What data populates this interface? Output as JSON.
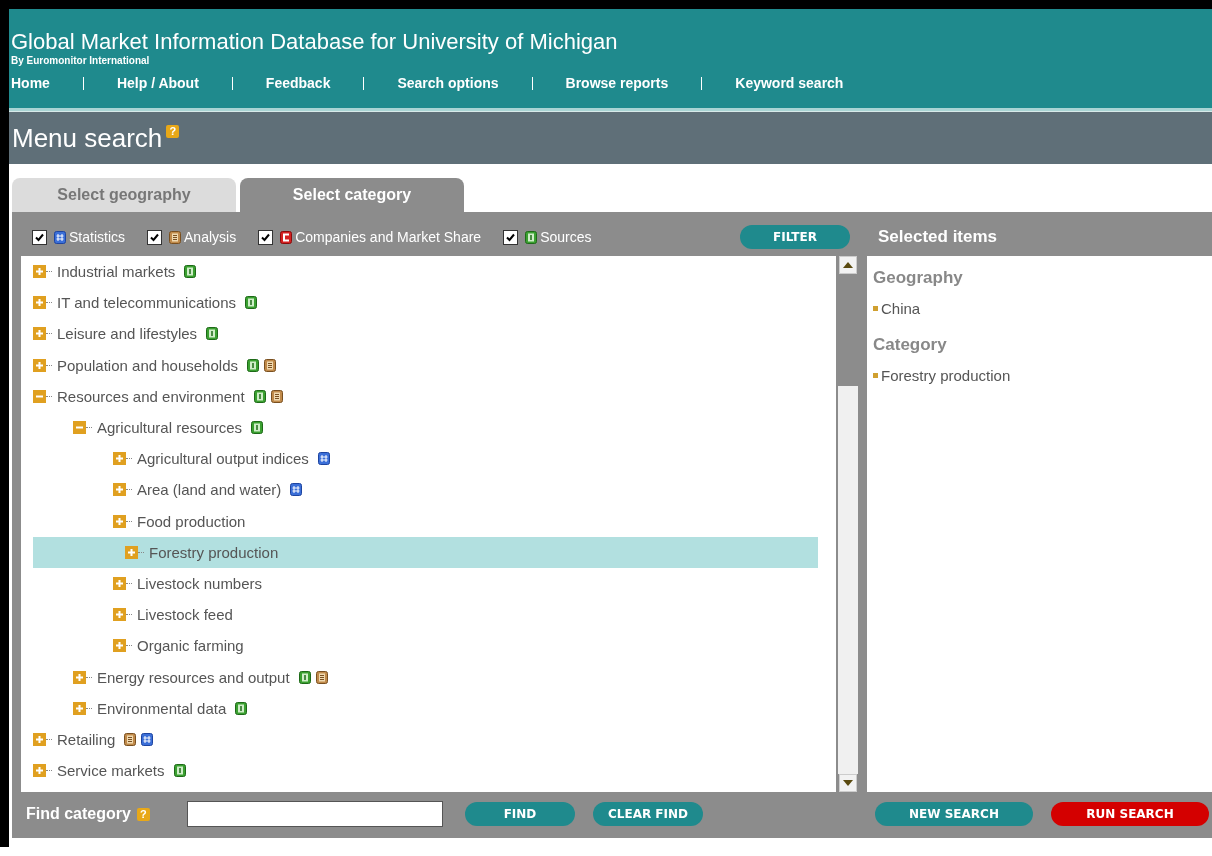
{
  "header": {
    "title": "Global Market Information Database for University of Michigan",
    "subtitle": "By Euromonitor International",
    "nav": [
      "Home",
      "Help / About",
      "Feedback",
      "Search options",
      "Browse reports",
      "Keyword search"
    ]
  },
  "page_title": {
    "text": "Menu search",
    "help": "?"
  },
  "tabs": [
    {
      "label": "Select geography",
      "selected": false
    },
    {
      "label": "Select category",
      "selected": true
    }
  ],
  "filters": [
    {
      "label": "Statistics",
      "kind": "statistics",
      "checked": true
    },
    {
      "label": "Analysis",
      "kind": "analysis",
      "checked": true
    },
    {
      "label": "Companies and Market Share",
      "kind": "companies",
      "checked": true
    },
    {
      "label": "Sources",
      "kind": "sources",
      "checked": true
    }
  ],
  "filter_button": {
    "label": "FILTER"
  },
  "tree": [
    {
      "label": "Industrial markets",
      "expanded": false,
      "selected": false,
      "badges": [
        {
          "kind": "sources"
        }
      ]
    },
    {
      "label": "IT and telecommunications",
      "expanded": false,
      "selected": false,
      "badges": [
        {
          "kind": "sources"
        }
      ]
    },
    {
      "label": "Leisure and lifestyles",
      "expanded": false,
      "selected": false,
      "badges": [
        {
          "kind": "sources"
        }
      ]
    },
    {
      "label": "Population and households",
      "expanded": false,
      "selected": false,
      "badges": [
        {
          "kind": "sources"
        },
        {
          "kind": "analysis"
        }
      ]
    },
    {
      "label": "Resources and environment",
      "expanded": true,
      "selected": false,
      "badges": [
        {
          "kind": "sources"
        },
        {
          "kind": "analysis"
        }
      ],
      "children": [
        {
          "label": "Agricultural resources",
          "expanded": true,
          "selected": false,
          "badges": [
            {
              "kind": "sources"
            }
          ],
          "children": [
            {
              "label": "Agricultural output indices",
              "expanded": false,
              "selected": false,
              "badges": [
                {
                  "kind": "statistics"
                }
              ]
            },
            {
              "label": "Area (land and water)",
              "expanded": false,
              "selected": false,
              "badges": [
                {
                  "kind": "statistics"
                }
              ]
            },
            {
              "label": "Food production",
              "expanded": false,
              "selected": false
            },
            {
              "label": "Forestry production",
              "expanded": false,
              "selected": true
            },
            {
              "label": "Livestock numbers",
              "expanded": false,
              "selected": false
            },
            {
              "label": "Livestock feed",
              "expanded": false,
              "selected": false
            },
            {
              "label": "Organic farming",
              "expanded": false,
              "selected": false
            }
          ]
        },
        {
          "label": "Energy resources and output",
          "expanded": false,
          "selected": false,
          "badges": [
            {
              "kind": "sources"
            },
            {
              "kind": "analysis"
            }
          ]
        },
        {
          "label": "Environmental data",
          "expanded": false,
          "selected": false,
          "badges": [
            {
              "kind": "sources"
            }
          ]
        }
      ]
    },
    {
      "label": "Retailing",
      "expanded": false,
      "selected": false,
      "badges": [
        {
          "kind": "analysis"
        },
        {
          "kind": "statistics"
        }
      ]
    },
    {
      "label": "Service markets",
      "expanded": false,
      "selected": false,
      "badges": [
        {
          "kind": "sources"
        }
      ]
    }
  ],
  "selected_items": {
    "title": "Selected items",
    "sections": [
      {
        "heading": "Geography",
        "items": [
          "China"
        ]
      },
      {
        "heading": "Category",
        "items": [
          "Forestry production"
        ]
      }
    ]
  },
  "find": {
    "label": "Find category",
    "help": "?"
  },
  "buttons": [
    {
      "label": "FIND",
      "kind": "normal"
    },
    {
      "label": "CLEAR FIND",
      "kind": "normal"
    },
    {
      "label": "NEW SEARCH",
      "kind": "normal"
    },
    {
      "label": "RUN SEARCH",
      "kind": "alert"
    }
  ]
}
